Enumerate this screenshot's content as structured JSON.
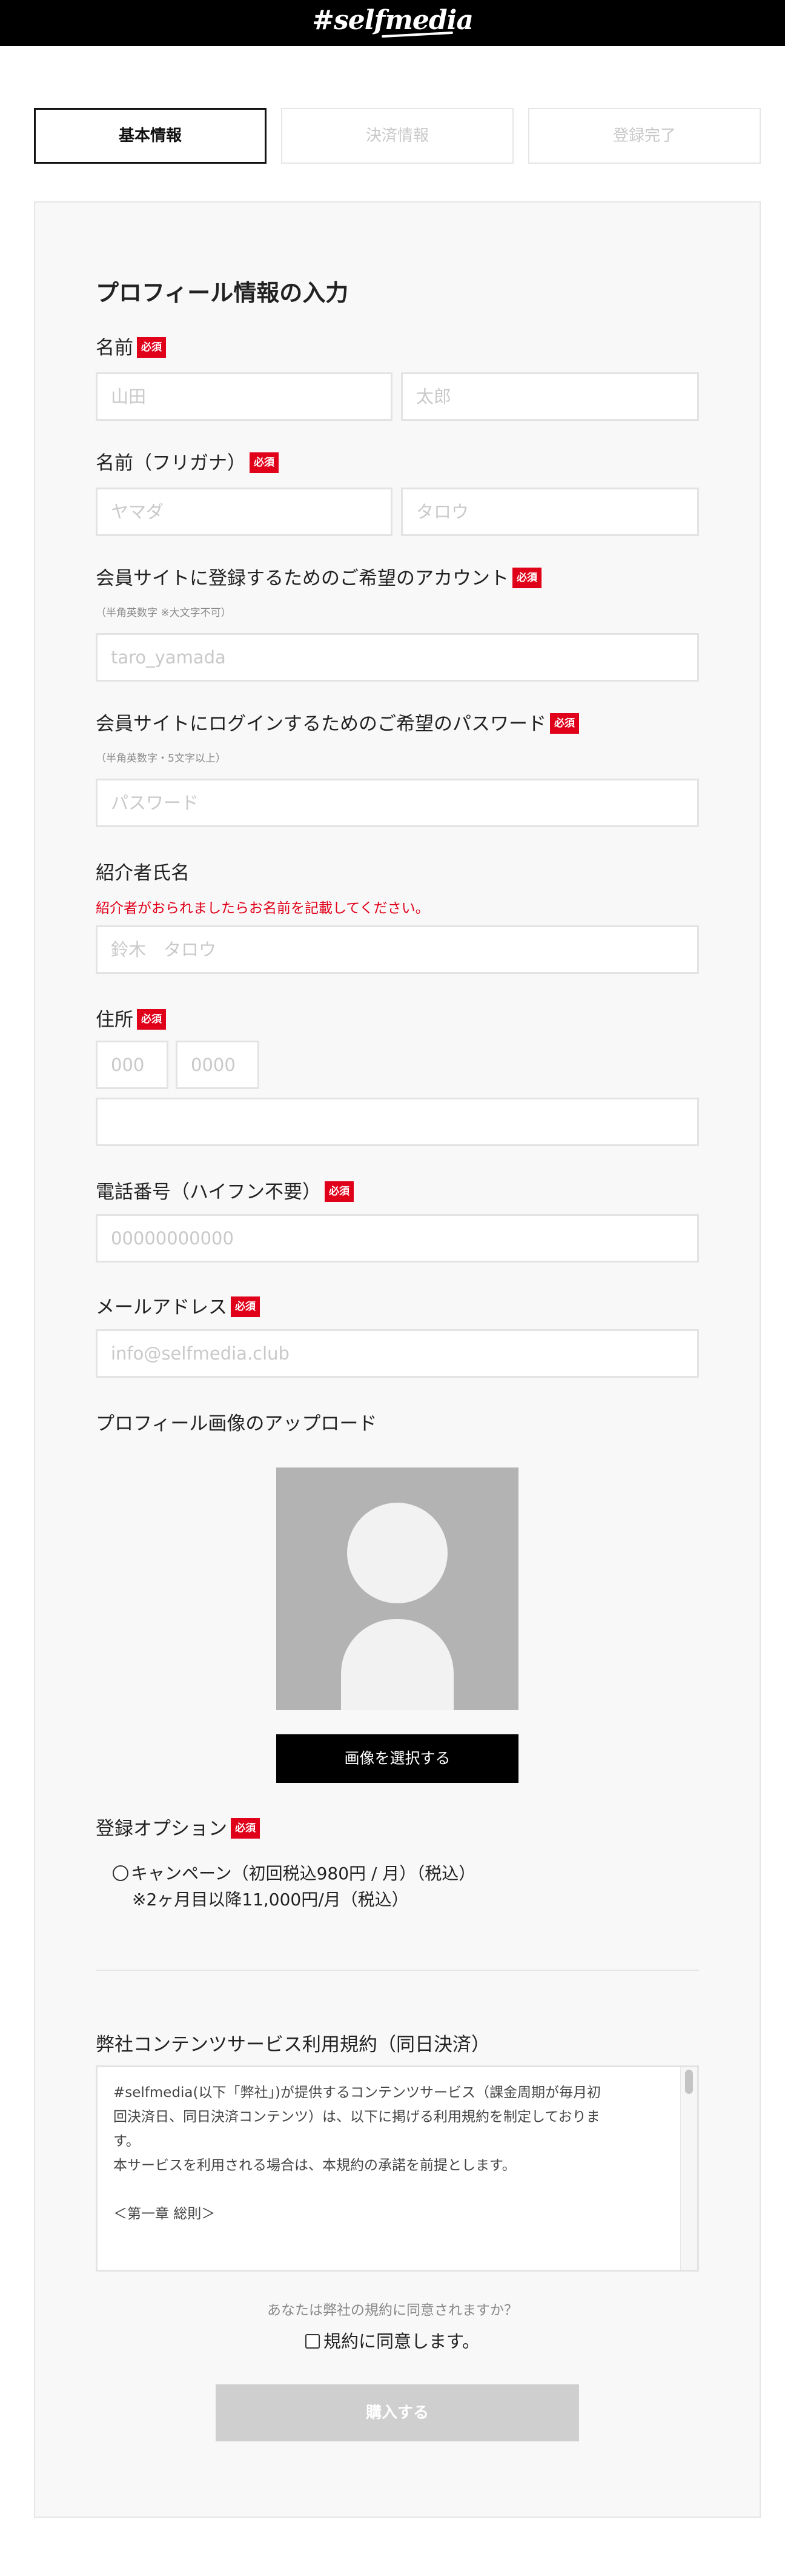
{
  "header": {
    "logo": "#selfmedia"
  },
  "steps": [
    {
      "label": "基本情報",
      "state": "active"
    },
    {
      "label": "決済情報",
      "state": "inactive"
    },
    {
      "label": "登録完了",
      "state": "inactive"
    }
  ],
  "form": {
    "title": "プロフィール情報の入力",
    "required_badge": "必須",
    "name": {
      "label": "名前",
      "last_placeholder": "山田",
      "first_placeholder": "太郎"
    },
    "kana": {
      "label": "名前（フリガナ）",
      "last_placeholder": "ヤマダ",
      "first_placeholder": "タロウ"
    },
    "account": {
      "label": "会員サイトに登録するためのご希望のアカウント",
      "hint": "（半角英数字 ※大文字不可）",
      "placeholder": "taro_yamada"
    },
    "password": {
      "label": "会員サイトにログインするためのご希望のパスワード",
      "hint": "（半角英数字・5文字以上）",
      "placeholder": "パスワード"
    },
    "referrer": {
      "label": "紹介者氏名",
      "note": "紹介者がおられましたらお名前を記載してください。",
      "placeholder": "鈴木　タロウ"
    },
    "address": {
      "label": "住所",
      "zip1_placeholder": "000",
      "zip2_placeholder": "0000",
      "address_value": ""
    },
    "phone": {
      "label": "電話番号（ハイフン不要）",
      "placeholder": "00000000000"
    },
    "email": {
      "label": "メールアドレス",
      "placeholder": "info@selfmedia.club"
    },
    "profile_image": {
      "label": "プロフィール画像のアップロード",
      "button": "画像を選択する"
    },
    "option": {
      "label": "登録オプション",
      "choice": "キャンペーン（初回税込980円 / 月）（税込）",
      "choice_note": "※2ヶ月目以降11,000円/月（税込）",
      "selected": false
    },
    "terms": {
      "label": "弊社コンテンツサービス利用規約（同日決済）",
      "lines": [
        "#selfmedia(以下「弊社」)が提供するコンテンツサービス（課金周期が毎月初",
        "回決済日、同日決済コンテンツ）は、以下に掲げる利用規約を制定しておりま",
        "す。",
        "本サービスを利用される場合は、本規約の承諾を前提とします。",
        "",
        "＜第一章 総則＞"
      ]
    },
    "agree_question": "あなたは弊社の規約に同意されますか？",
    "agree_label": "規約に同意します。",
    "agree_checked": false,
    "submit": "購入する"
  },
  "colors": {
    "accent_red": "#e0001a",
    "header_bg": "#000000",
    "card_bg": "#f8f8f8",
    "disabled_button": "#cfcfcf"
  }
}
